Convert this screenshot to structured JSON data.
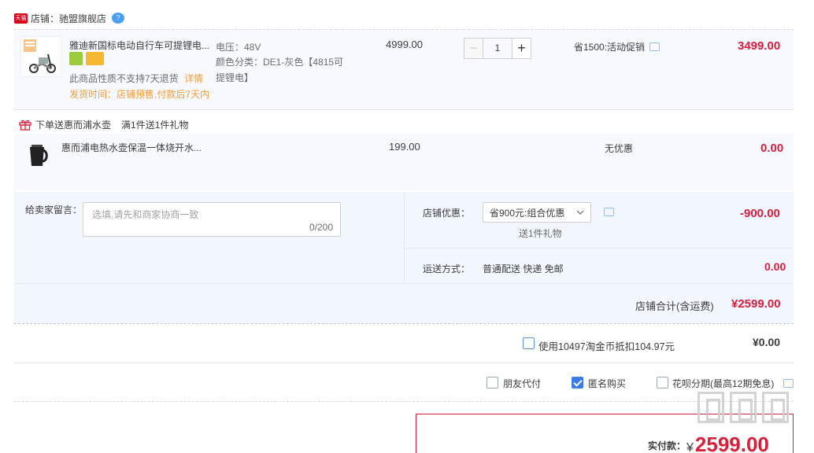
{
  "shop": {
    "badge": "天猫",
    "label": "店铺：驰盟旗舰店"
  },
  "item1": {
    "name": "雅迪新国标电动自行车可提锂电...",
    "spec_voltage": "电压：48V",
    "spec_color_1": "颜色分类：DE1-灰色【4815可",
    "spec_color_2": "提锂电】",
    "unit_price": "4999.00",
    "quantity": "1",
    "promo": "省1500:活动促销",
    "subtotal": "3499.00",
    "no_return": "此商品性质不支持7天退货",
    "detail_link": "详情",
    "ship_time": "发货时间：店铺预售,付款后7天内"
  },
  "gift": {
    "banner": "下单送惠而浦水壶",
    "rule": "满1件送1件礼物",
    "name": "惠而浦电热水壶保温一体烧开水...",
    "unit_price": "199.00",
    "promo": "无优惠",
    "subtotal": "0.00"
  },
  "message": {
    "label": "给卖家留言：",
    "placeholder": "选填,请先和商家协商一致",
    "counter": "0/200"
  },
  "discount": {
    "label": "店铺优惠：",
    "selected": "省900元:组合优惠",
    "sub_note": "送1件礼物",
    "amount": "-900.00"
  },
  "shipping": {
    "label": "运送方式：",
    "method": "普通配送 快递 免邮",
    "amount": "0.00"
  },
  "shop_total": {
    "label": "店铺合计(含运费)",
    "amount": "¥2599.00"
  },
  "coins": {
    "label": "使用10497淘金币抵扣104.97元",
    "amount": "¥0.00"
  },
  "options": {
    "friend_pay": "朋友代付",
    "anonymous": "匿名购买",
    "huabei": "花呗分期(最高12期免息)"
  },
  "payment": {
    "label": "实付款：",
    "currency": "¥",
    "amount": "2599.00"
  },
  "colors": {
    "accent_red": "#d91e3c",
    "orange": "#f29c39",
    "blue": "#3d7be8"
  }
}
